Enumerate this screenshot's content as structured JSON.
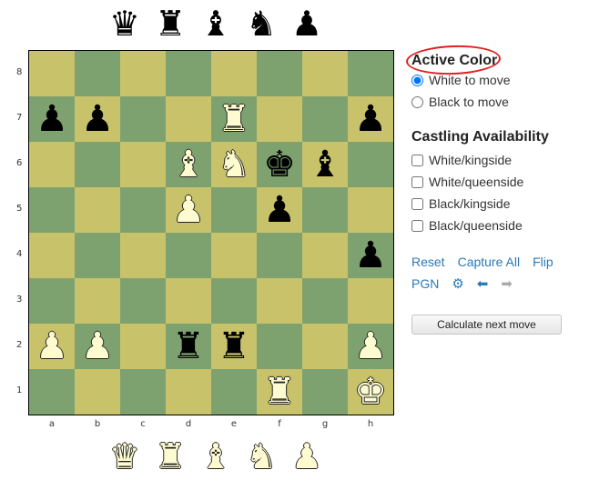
{
  "spare_pieces": {
    "black": [
      {
        "name": "queen",
        "glyph": "♛"
      },
      {
        "name": "rook",
        "glyph": "♜"
      },
      {
        "name": "bishop",
        "glyph": "♝"
      },
      {
        "name": "knight",
        "glyph": "♞"
      },
      {
        "name": "pawn",
        "glyph": "♟"
      }
    ],
    "white": [
      {
        "name": "queen",
        "glyph": "♛"
      },
      {
        "name": "rook",
        "glyph": "♜"
      },
      {
        "name": "bishop",
        "glyph": "♝"
      },
      {
        "name": "knight",
        "glyph": "♞"
      },
      {
        "name": "pawn",
        "glyph": "♟"
      }
    ]
  },
  "board": {
    "ranks": [
      "8",
      "7",
      "6",
      "5",
      "4",
      "3",
      "2",
      "1"
    ],
    "files": [
      "a",
      "b",
      "c",
      "d",
      "e",
      "f",
      "g",
      "h"
    ],
    "pieces": {
      "a7": {
        "color": "b",
        "type": "pawn",
        "glyph": "♟"
      },
      "b7": {
        "color": "b",
        "type": "pawn",
        "glyph": "♟"
      },
      "e7": {
        "color": "w",
        "type": "rook",
        "glyph": "♜"
      },
      "h7": {
        "color": "b",
        "type": "pawn",
        "glyph": "♟"
      },
      "d6": {
        "color": "w",
        "type": "bishop",
        "glyph": "♝"
      },
      "e6": {
        "color": "w",
        "type": "knight",
        "glyph": "♞"
      },
      "f6": {
        "color": "b",
        "type": "king",
        "glyph": "♚"
      },
      "g6": {
        "color": "b",
        "type": "bishop",
        "glyph": "♝"
      },
      "d5": {
        "color": "w",
        "type": "pawn",
        "glyph": "♟"
      },
      "f5": {
        "color": "b",
        "type": "pawn",
        "glyph": "♟"
      },
      "h4": {
        "color": "b",
        "type": "pawn",
        "glyph": "♟"
      },
      "a2": {
        "color": "w",
        "type": "pawn",
        "glyph": "♟"
      },
      "b2": {
        "color": "w",
        "type": "pawn",
        "glyph": "♟"
      },
      "d2": {
        "color": "b",
        "type": "rook",
        "glyph": "♜"
      },
      "e2": {
        "color": "b",
        "type": "rook",
        "glyph": "♜"
      },
      "h2": {
        "color": "w",
        "type": "pawn",
        "glyph": "♟"
      },
      "f1": {
        "color": "w",
        "type": "rook",
        "glyph": "♜"
      },
      "h1": {
        "color": "w",
        "type": "king",
        "glyph": "♚"
      }
    },
    "colors": {
      "light": "#c8c26a",
      "dark": "#7ea26f"
    }
  },
  "panel": {
    "active_color": {
      "heading": "Active Color",
      "options": [
        {
          "label": "White to move",
          "checked": true
        },
        {
          "label": "Black to move",
          "checked": false
        }
      ]
    },
    "castling": {
      "heading": "Castling Availability",
      "options": [
        {
          "label": "White/kingside",
          "checked": false
        },
        {
          "label": "White/queenside",
          "checked": false
        },
        {
          "label": "Black/kingside",
          "checked": false
        },
        {
          "label": "Black/queenside",
          "checked": false
        }
      ]
    },
    "links": {
      "reset": "Reset",
      "capture_all": "Capture All",
      "flip": "Flip",
      "pgn": "PGN"
    },
    "icons": {
      "settings": "⚙",
      "back": "⬅",
      "forward": "➡"
    },
    "calculate_button": "Calculate next move"
  }
}
